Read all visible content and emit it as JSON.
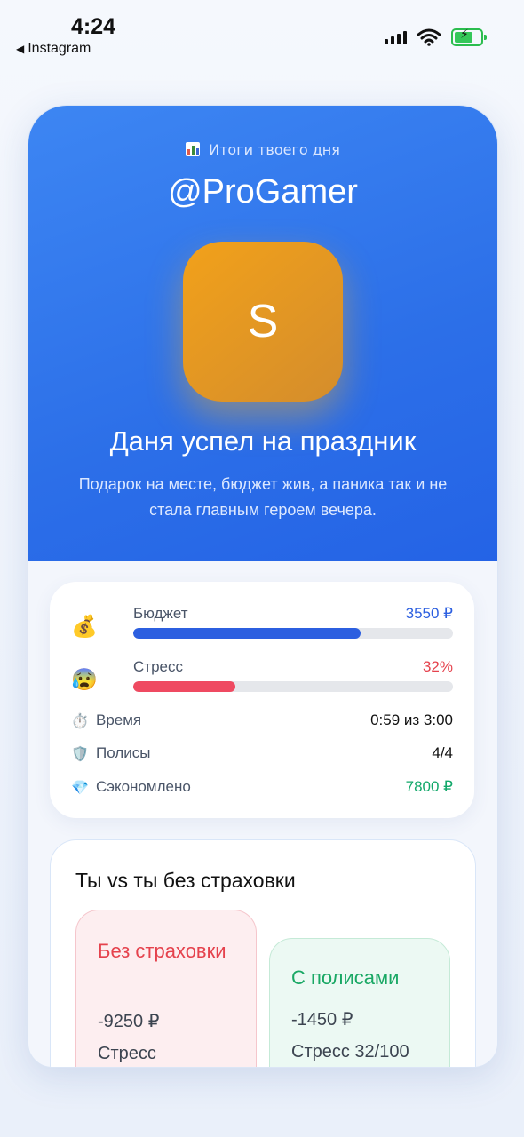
{
  "status_bar": {
    "time": "4:24",
    "back_label": "Instagram"
  },
  "hero": {
    "subtitle": "Итоги твоего дня",
    "handle": "@ProGamer",
    "avatar_letter": "S",
    "title": "Даня успел на праздник",
    "description": "Подарок на месте, бюджет жив, а паника так и не стала главным героем вечера."
  },
  "stats": {
    "budget": {
      "emoji": "💰",
      "label": "Бюджет",
      "value": "3550 ₽",
      "level_percent": 71,
      "color": "#2c5fe0"
    },
    "stress": {
      "emoji": "😰",
      "label": "Стресс",
      "value": "32%",
      "level_percent": 32,
      "color": "#ef4a61"
    },
    "time": {
      "emoji": "⏱️",
      "label": "Время",
      "value": "0:59 из 3:00"
    },
    "policies": {
      "emoji": "🛡️",
      "label": "Полисы",
      "value": "4/4"
    },
    "saved": {
      "emoji": "💎",
      "label": "Сэкономлено",
      "value": "7800 ₽",
      "color": "#12a86a"
    }
  },
  "compare": {
    "title": "Ты vs ты без страховки",
    "without": {
      "title": "Без страховки",
      "amount": "-9250 ₽",
      "stress": "Стресс"
    },
    "with": {
      "title": "С полисами",
      "amount": "-1450 ₽",
      "stress": "Стресс 32/100"
    }
  }
}
